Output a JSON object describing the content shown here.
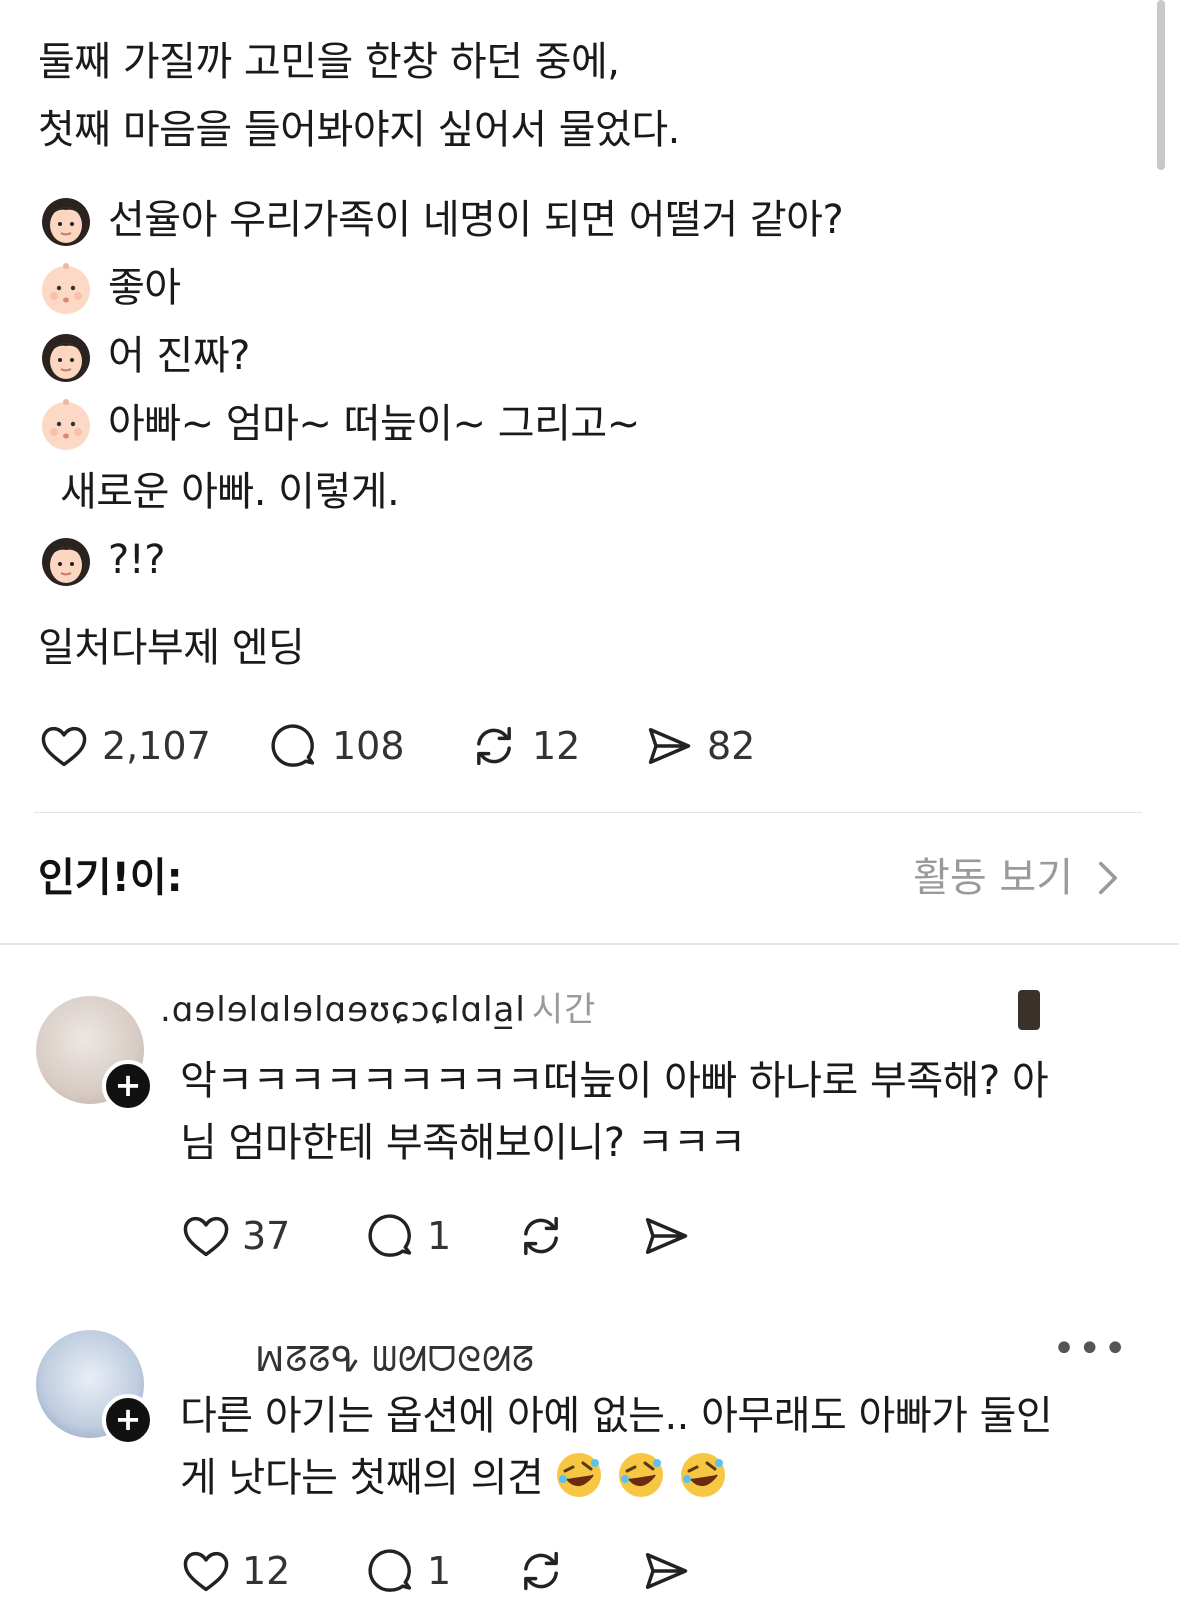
{
  "post": {
    "lines": [
      "둘째 가질까 고민을 한창 하던 중에,",
      "첫째 마음을 들어봐야지 싶어서 물었다."
    ],
    "dialogue": [
      {
        "speaker_icon": "woman-emoji",
        "text": "선율아 우리가족이 네명이 되면 어떨거 같아?"
      },
      {
        "speaker_icon": "baby-emoji",
        "text": "좋아"
      },
      {
        "speaker_icon": "woman-emoji",
        "text": "어 진짜?"
      },
      {
        "speaker_icon": "baby-emoji",
        "text": "아빠~ 엄마~ 떠늪이~ 그리고~"
      },
      {
        "speaker_icon": "",
        "text": "새로운 아빠. 이렇게."
      },
      {
        "speaker_icon": "woman-emoji",
        "text": "?!?"
      }
    ],
    "ending": "일처다부제 엔딩",
    "stats": {
      "likes": "2,107",
      "comments": "108",
      "reposts": "12",
      "shares": "82"
    }
  },
  "section": {
    "popular_label": "인기!이:",
    "activity_link": "활동 보기"
  },
  "comments": [
    {
      "username": ".ɑɘlɘlɑlɘlɑɘʊɕɔɕlɑla̲l",
      "time": "시간",
      "text_line1": "악ㅋㅋㅋㅋㅋㅋㅋㅋㅋ떠늪이 아빠 하나로 부족해? 아",
      "text_line2": "님 엄마한테 부족해보이니? ㅋㅋㅋ",
      "likes": "37",
      "replies": "1"
    },
    {
      "username": "ꟽᘔᘔᕴ ᗯᘛᗜᘓᘛᘔ",
      "more": "•••",
      "text_line1": "다른 아기는 옵션에 아예 없는.. 아무래도 아빠가 둘인",
      "text_line2": "게 낫다는 첫째의 의견",
      "emoji_icon": "rolling-laughing-emoji",
      "likes": "12",
      "replies": "1"
    }
  ]
}
